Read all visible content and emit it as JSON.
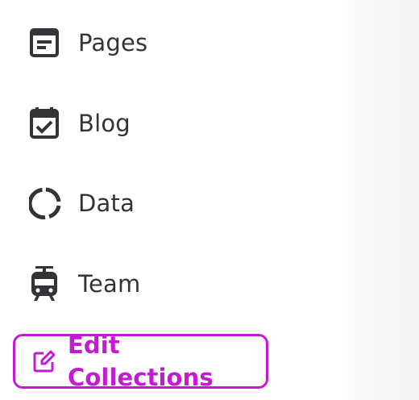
{
  "nav": {
    "items": [
      {
        "id": "pages",
        "label": "Pages",
        "icon": "document-icon"
      },
      {
        "id": "blog",
        "label": "Blog",
        "icon": "calendar-check-icon"
      },
      {
        "id": "data",
        "label": "Data",
        "icon": "donut-chart-icon"
      },
      {
        "id": "team",
        "label": "Team",
        "icon": "tram-icon"
      }
    ]
  },
  "actions": {
    "edit_collections_label": "Edit Collections",
    "edit_icon": "edit-square-icon"
  },
  "colors": {
    "text": "#333438",
    "accent": "#c21bd1",
    "background": "#ffffff",
    "panel": "#f4f4f5"
  }
}
